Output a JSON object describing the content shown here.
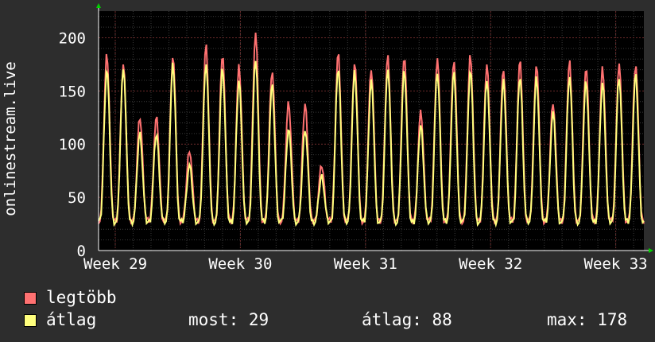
{
  "chart_data": {
    "type": "line",
    "ylabel": "onlinestream.live",
    "ylim": [
      0,
      225
    ],
    "yticks": [
      0,
      50,
      100,
      150,
      200
    ],
    "x_ticks": [
      "Week 29",
      "Week 30",
      "Week 31",
      "Week 32",
      "Week 33"
    ],
    "grid": true,
    "legend_position": "bottom",
    "series": [
      {
        "name": "legtöbb",
        "color": "#ff7171",
        "peaks": [
          185,
          175,
          125,
          125,
          183,
          95,
          193,
          185,
          173,
          204,
          170,
          140,
          138,
          80,
          185,
          177,
          172,
          183,
          183,
          130,
          180,
          180,
          184,
          175,
          171,
          178,
          175,
          140,
          178,
          173,
          171,
          175,
          176
        ],
        "trough": 28
      },
      {
        "name": "átlag",
        "color": "#ffff7d",
        "peaks": [
          171,
          173,
          110,
          110,
          175,
          80,
          177,
          172,
          160,
          180,
          155,
          115,
          115,
          70,
          172,
          168,
          160,
          172,
          170,
          118,
          168,
          167,
          170,
          162,
          160,
          164,
          162,
          130,
          165,
          160,
          158,
          163,
          165
        ],
        "trough": 27
      }
    ],
    "legend": [
      {
        "label": "legtöbb",
        "color": "#ff7171"
      },
      {
        "label": "átlag",
        "color": "#ffff7d"
      }
    ],
    "stats": {
      "most_label": "most:",
      "most_value": "29",
      "atlag_label": "átlag:",
      "atlag_value": "88",
      "max_label": "max:",
      "max_value": "178"
    }
  }
}
